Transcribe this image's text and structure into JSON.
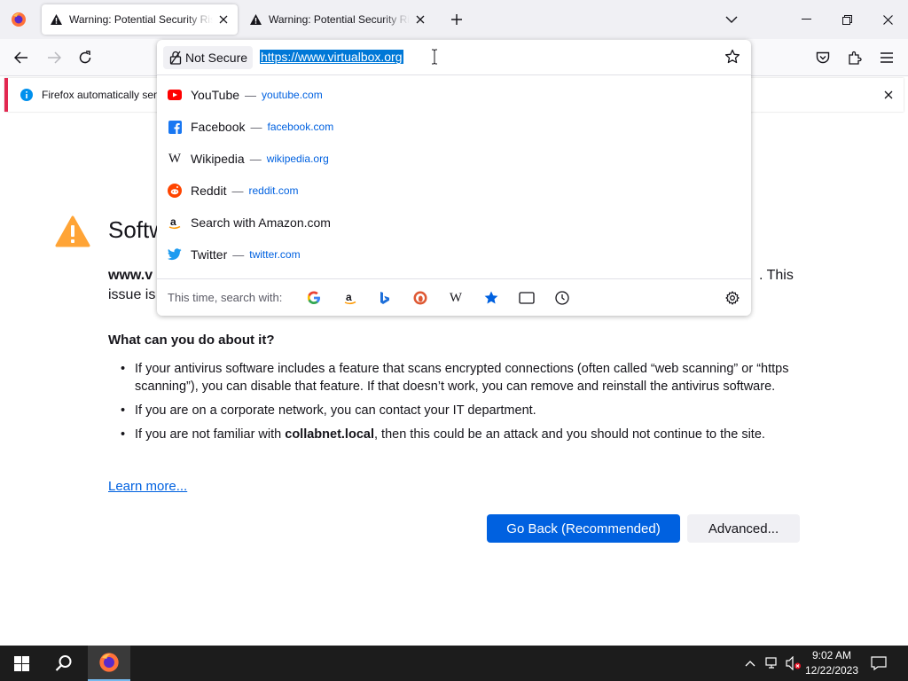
{
  "tabs": [
    {
      "title": "Warning: Potential Security Risk Ahead"
    },
    {
      "title": "Warning: Potential Security Risk Ahead"
    }
  ],
  "urlbar": {
    "security_label": "Not Secure",
    "url": "https://www.virtualbox.org"
  },
  "notification": {
    "text": "Firefox automatically sen"
  },
  "error_page": {
    "title": "Softw",
    "para_start": "www.v",
    "para_tail": ". This",
    "para_line2": "issue is",
    "subheading": "What can you do about it?",
    "bullet1": "If your antivirus software includes a feature that scans encrypted connections (often called “web scanning” or “https scanning”), you can disable that feature. If that doesn’t work, you can remove and reinstall the antivirus software.",
    "bullet2": "If you are on a corporate network, you can contact your IT department.",
    "bullet3_pre": "If you are not familiar with ",
    "bullet3_bold": "collabnet.local",
    "bullet3_post": ", then this could be an attack and you should not continue to the site.",
    "learn_more": "Learn more...",
    "go_back": "Go Back (Recommended)",
    "advanced": "Advanced..."
  },
  "suggestions": [
    {
      "name": "YouTube",
      "domain": "youtube.com",
      "icon": "youtube-icon"
    },
    {
      "name": "Facebook",
      "domain": "facebook.com",
      "icon": "facebook-icon"
    },
    {
      "name": "Wikipedia",
      "domain": "wikipedia.org",
      "icon": "wikipedia-icon"
    },
    {
      "name": "Reddit",
      "domain": "reddit.com",
      "icon": "reddit-icon"
    },
    {
      "name": "Search with Amazon.com",
      "domain": "",
      "icon": "amazon-icon"
    },
    {
      "name": "Twitter",
      "domain": "twitter.com",
      "icon": "twitter-icon"
    }
  ],
  "search_row": {
    "label": "This time, search with:"
  },
  "taskbar": {
    "time": "9:02 AM",
    "date": "12/22/2023"
  },
  "colors": {
    "accent": "#0061e0",
    "warning": "#ffa436",
    "highlight": "#0078d7"
  }
}
